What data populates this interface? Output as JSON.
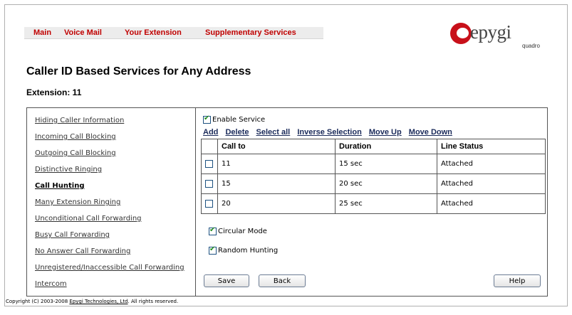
{
  "nav": {
    "items": [
      "Main",
      "Voice Mail",
      "Your Extension",
      "Supplementary Services"
    ]
  },
  "logo": {
    "text": "epygi",
    "sub": "quadro"
  },
  "page": {
    "title": "Caller ID Based Services for Any Address",
    "extension": "Extension: 11"
  },
  "sidebar": {
    "items": [
      "Hiding Caller Information",
      "Incoming Call Blocking",
      "Outgoing Call Blocking",
      "Distinctive Ringing",
      "Call Hunting",
      "Many Extension Ringing",
      "Unconditional Call Forwarding",
      "Busy Call Forwarding",
      "No Answer Call Forwarding",
      "Unregistered/Inaccessible Call Forwarding",
      "Intercom"
    ],
    "active_index": 4
  },
  "content": {
    "enable_service": {
      "label": "Enable Service",
      "checked": true
    },
    "actions": [
      "Add",
      "Delete",
      "Select all",
      "Inverse Selection",
      "Move Up",
      "Move Down"
    ],
    "table": {
      "headers": [
        "Call to",
        "Duration",
        "Line Status"
      ],
      "rows": [
        {
          "call_to": "11",
          "duration": "15 sec",
          "line_status": "Attached",
          "checked": false
        },
        {
          "call_to": "15",
          "duration": "20 sec",
          "line_status": "Attached",
          "checked": false
        },
        {
          "call_to": "20",
          "duration": "25 sec",
          "line_status": "Attached",
          "checked": false
        }
      ]
    },
    "circular_mode": {
      "label": "Circular Mode",
      "checked": true
    },
    "random_hunting": {
      "label": "Random Hunting",
      "checked": true
    },
    "buttons": {
      "save": "Save",
      "back": "Back",
      "help": "Help"
    }
  },
  "footer": {
    "prefix": "Copyright (C) 2003-2008 ",
    "company": "Epygi Technologies, Ltd",
    "suffix": ". All rights reserved."
  },
  "colors": {
    "nav_text": "#c00000",
    "logo_red": "#c8101a",
    "check_green": "#1f8a1f"
  }
}
